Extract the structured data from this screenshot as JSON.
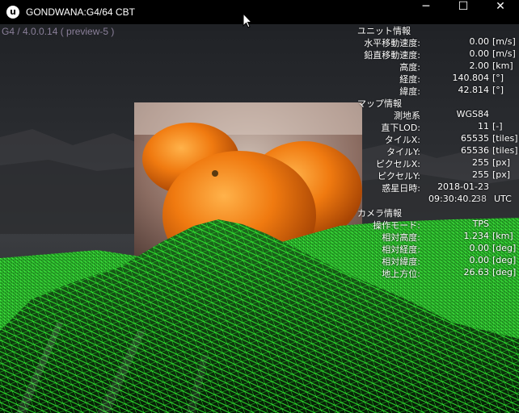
{
  "window": {
    "app_icon": "unreal-engine-logo",
    "title": "GONDWANA:G4/64 CBT",
    "controls": {
      "minimize": "─",
      "maximize": "☐",
      "close": "✕"
    }
  },
  "version": "G4 / 4.0.0.14 ( preview-5 )",
  "hud": {
    "unit_info": {
      "header": "ユニット情報",
      "rows": [
        {
          "label": "水平移動速度:",
          "value": "0.00",
          "unit": "[m/s]"
        },
        {
          "label": "鉛直移動速度:",
          "value": "0.00",
          "unit": "[m/s]"
        },
        {
          "label": "高度:",
          "value": "2.00",
          "unit": "[km]"
        },
        {
          "label": "経度:",
          "value": "140.804",
          "unit": "[°]"
        },
        {
          "label": "緯度:",
          "value": "42.814",
          "unit": "[°]"
        }
      ]
    },
    "map_info": {
      "header": "マップ情報",
      "rows": [
        {
          "label": "測地系",
          "value": "WGS84",
          "unit": ""
        },
        {
          "label": "直下LOD:",
          "value": "11",
          "unit": "[-]"
        },
        {
          "label": "タイルX:",
          "value": "65535",
          "unit": "[tiles]"
        },
        {
          "label": "タイルY:",
          "value": "65536",
          "unit": "[tiles]"
        },
        {
          "label": "ピクセルX:",
          "value": "255",
          "unit": "[px]"
        },
        {
          "label": "ピクセルY:",
          "value": "255",
          "unit": "[px]"
        },
        {
          "label": "惑星日時:",
          "value": "2018-01-23",
          "unit": ""
        }
      ],
      "time": "09:30:40.2",
      "time_overlap": "38",
      "time_zone": "UTC"
    },
    "camera_info": {
      "header": "カメラ情報",
      "rows": [
        {
          "label": "操作モード:",
          "value": "TPS",
          "unit": ""
        },
        {
          "label": "相対高度:",
          "value": "1.234",
          "unit": "[km]"
        },
        {
          "label": "相対経度:",
          "value": "0.00",
          "unit": "[deg]"
        },
        {
          "label": "相対緯度:",
          "value": "0.00",
          "unit": "[deg]"
        },
        {
          "label": "地上方位:",
          "value": "26.63",
          "unit": "[deg]"
        }
      ]
    }
  },
  "colors": {
    "terrain_wire": "#34ff34",
    "terrain_fill": "#0a3a0a",
    "sky_top": "#202226",
    "version_text": "#8a7f99"
  }
}
